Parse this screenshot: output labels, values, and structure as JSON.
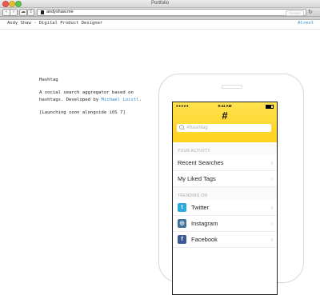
{
  "window": {
    "title": "Portfolio"
  },
  "toolbar": {
    "url": "andyshaw.me",
    "reader_label": "Reader"
  },
  "header": {
    "brand": "Andy Shaw - Digital Product Designer",
    "link": "Alrest"
  },
  "project": {
    "title": "Hashtag",
    "description_prefix": "A social search aggregator based on hashtags. Developed by ",
    "developer": "Michael Loistl",
    "description_suffix": ".",
    "note": "[Launching soon alongside iOS 7]"
  },
  "app": {
    "status": {
      "signal": "●●●●●",
      "time": "9:41 AM"
    },
    "logo": "#",
    "search_placeholder": "#hashtag",
    "activity_section": "YOUR ACTIVITY",
    "activity_items": [
      "Recent Searches",
      "My Liked Tags"
    ],
    "trending_section": "TRENDING ON",
    "trending_items": [
      {
        "label": "Twitter",
        "icon": "twitter-icon",
        "color": "#2aa9e0"
      },
      {
        "label": "Instagram",
        "icon": "instagram-icon",
        "color": "#3f729b"
      },
      {
        "label": "Facebook",
        "icon": "facebook-icon",
        "color": "#3b5998"
      }
    ]
  },
  "colors": {
    "accent": "#ffd21f",
    "link": "#2d86c8"
  }
}
